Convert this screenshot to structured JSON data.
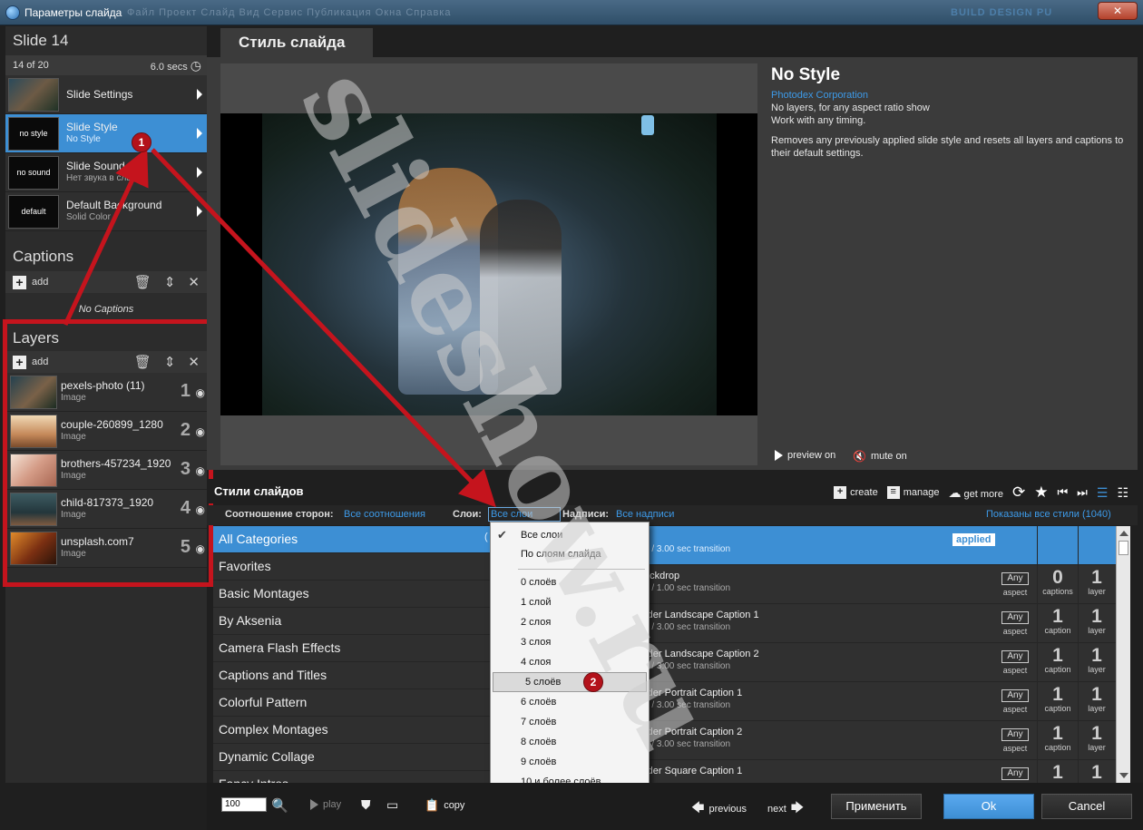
{
  "window": {
    "title": "Параметры слайда",
    "ghost_menu": "Файл   Проект   Слайд   Вид   Сервис   Публикация   Окна   Справка",
    "ghost_right": "BUILD   DESIGN   PU",
    "close_glyph": "✕"
  },
  "slide": {
    "title": "Slide 14",
    "position": "14 of 20",
    "duration": "6.0 secs"
  },
  "slide_items": [
    {
      "thumb": "",
      "title": "Slide Settings",
      "sub": ""
    },
    {
      "thumb": "no style",
      "title": "Slide Style",
      "sub": "No Style"
    },
    {
      "thumb": "no sound",
      "title": "Slide Sound",
      "sub": "Нет звука в слайде"
    },
    {
      "thumb": "default",
      "title": "Default Background",
      "sub": "Solid Color"
    }
  ],
  "captions": {
    "title": "Captions",
    "add": "add",
    "empty": "No Captions"
  },
  "layers": {
    "title": "Layers",
    "add": "add",
    "items": [
      {
        "name": "pexels-photo (11)",
        "type": "Image",
        "num": "1"
      },
      {
        "name": "couple-260899_1280",
        "type": "Image",
        "num": "2"
      },
      {
        "name": "brothers-457234_1920",
        "type": "Image",
        "num": "3"
      },
      {
        "name": "child-817373_1920",
        "type": "Image",
        "num": "4"
      },
      {
        "name": "unsplash.com7",
        "type": "Image",
        "num": "5"
      }
    ]
  },
  "tab": {
    "label": "Стиль слайда"
  },
  "preview": {
    "preview_on": "preview on",
    "mute_on": "mute on"
  },
  "style_info": {
    "name": "No Style",
    "author": "Photodex Corporation",
    "line1": "No layers, for any aspect ratio show",
    "line2": "Work with any timing.",
    "desc": "Removes any previously applied slide style and resets all layers and captions to their default settings."
  },
  "styles": {
    "section_title": "Стили слайдов",
    "create": "create",
    "manage": "manage",
    "get_more": "get more",
    "filter_aspect_label": "Соотношение сторон:",
    "filter_aspect_value": "Все соотношения",
    "filter_layers_label": "Слои:",
    "filter_layers_value": "Все слои",
    "filter_captions_label": "Надписи:",
    "filter_captions_value": "Все надписи",
    "shown": "Показаны все стили (1040)"
  },
  "categories": [
    "All Categories",
    "Favorites",
    "Basic Montages",
    "By Aksenia",
    "Camera Flash Effects",
    "Captions and Titles",
    "Colorful Pattern",
    "Complex Montages",
    "Dynamic Collage",
    "Fancy Intros"
  ],
  "category_count": "(",
  "style_rows": [
    {
      "name": "",
      "sub": "e / 3.00 sec transition",
      "badge": "applied",
      "aspect_box": "",
      "aspect": "",
      "captions": "",
      "captions_label": "",
      "layers": "",
      "layers_label": ""
    },
    {
      "name": "ackdrop",
      "sub": "e / 1.00 sec transition",
      "badge": "",
      "aspect_box": "Any",
      "aspect": "aspect",
      "captions": "0",
      "captions_label": "captions",
      "layers": "1",
      "layers_label": "layer"
    },
    {
      "name": "rder Landscape Caption 1",
      "sub": "e / 3.00 sec transition",
      "badge": "",
      "aspect_box": "Any",
      "aspect": "aspect",
      "captions": "1",
      "captions_label": "caption",
      "layers": "1",
      "layers_label": "layer"
    },
    {
      "name": "rder Landscape Caption 2",
      "sub": "e / 3.00 sec transition",
      "badge": "",
      "aspect_box": "Any",
      "aspect": "aspect",
      "captions": "1",
      "captions_label": "caption",
      "layers": "1",
      "layers_label": "layer"
    },
    {
      "name": "rder Portrait Caption 1",
      "sub": "e / 3.00 sec transition",
      "badge": "",
      "aspect_box": "Any",
      "aspect": "aspect",
      "captions": "1",
      "captions_label": "caption",
      "layers": "1",
      "layers_label": "layer"
    },
    {
      "name": "rder Portrait Caption 2",
      "sub": "e / 3.00 sec transition",
      "badge": "",
      "aspect_box": "Any",
      "aspect": "aspect",
      "captions": "1",
      "captions_label": "caption",
      "layers": "1",
      "layers_label": "layer"
    },
    {
      "name": "rder Square Caption 1",
      "sub": "",
      "badge": "",
      "aspect_box": "Any",
      "aspect": "",
      "captions": "1",
      "captions_label": "",
      "layers": "1",
      "layers_label": ""
    }
  ],
  "layers_dropdown": {
    "options_top": [
      "Все слои",
      "По слоям слайда"
    ],
    "options": [
      "0 слоёв",
      "1 слой",
      "2 слоя",
      "3 слоя",
      "4 слоя",
      "5 слоёв",
      "6 слоёв",
      "7 слоёв",
      "8 слоёв",
      "9 слоёв",
      "10 и более слоёв"
    ],
    "checked": "Все слои",
    "highlighted": "5 слоёв"
  },
  "bottom": {
    "zoom": "100",
    "play": "play",
    "copy": "copy",
    "previous": "previous",
    "next": "next",
    "apply": "Применить",
    "ok": "Ok",
    "cancel": "Cancel"
  },
  "annotations": {
    "badge1": "1",
    "badge2": "2",
    "watermark": "slideshow.ru",
    "color": "#c5141d"
  },
  "colors": {
    "accent": "#3d8fd4",
    "link": "#3d9ae8",
    "panel": "#2c2c2c"
  }
}
